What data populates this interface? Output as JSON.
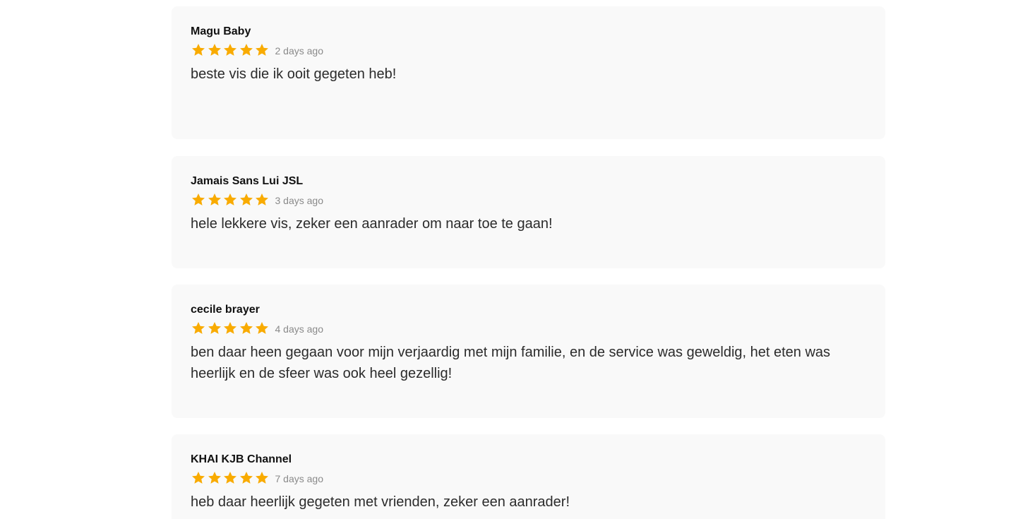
{
  "colors": {
    "star": "#f9ab00",
    "card_bg": "#f9f9f9",
    "time": "#8a8a8a",
    "text": "#2b2b2b"
  },
  "reviews": [
    {
      "author": "Magu Baby",
      "rating": 5,
      "time": "2 days ago",
      "text": "beste vis die ik ooit gegeten heb!"
    },
    {
      "author": "Jamais Sans Lui JSL",
      "rating": 5,
      "time": "3 days ago",
      "text": "hele lekkere vis, zeker een aanrader om naar toe te gaan!"
    },
    {
      "author": "cecile brayer",
      "rating": 5,
      "time": "4 days ago",
      "text": "ben daar heen gegaan voor mijn verjaardig met mijn familie, en de service was geweldig, het eten was heerlijk en de sfeer was ook heel gezellig!"
    },
    {
      "author": "KHAI KJB Channel",
      "rating": 5,
      "time": "7 days ago",
      "text": "heb daar heerlijk gegeten met vrienden, zeker een aanrader!"
    }
  ]
}
